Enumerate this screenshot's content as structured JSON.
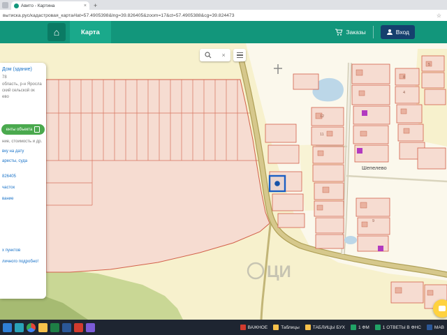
{
  "browser": {
    "tab_title": "Авито - Картина",
    "tab_close": "×",
    "new_tab_label": "+",
    "url": "вытиска.рус/кадастровая_карта#lat=57.4905398&lng=39.826405&zoom=17&ct=57.4905388&cg=39.824473",
    "bookmark_star": "☆"
  },
  "header": {
    "home_glyph": "⌂",
    "map_tab_label": "Карта",
    "orders_label": "Заказы",
    "login_label": "Вход"
  },
  "map_controls": {
    "clear_label": "×"
  },
  "panel": {
    "title_link": "Дом (здание)",
    "code_line": "78",
    "address_line1": "область, р-н Яросла",
    "address_line2": "ский сельской ок",
    "address_line3": "ево",
    "docs_button_label": "енты объекта",
    "info_line": "ние, стоимость и др.",
    "link_extract_date": "вку на дату",
    "link_arrests": "аресты, суда",
    "link_number": "826405",
    "link_parcel": "часток",
    "link_building": "вание",
    "link_settlements": "х пунктов",
    "link_more": "личного подробно!"
  },
  "map": {
    "village_label": "Шепелево",
    "parcel_numbers": [
      "8",
      "4",
      "12",
      "11",
      "5",
      "9"
    ],
    "watermark_text": "ЦИ"
  },
  "taskbar": {
    "items": [
      {
        "icon": "important-icon",
        "label": "ВАЖНОЕ"
      },
      {
        "icon": "folder-icon",
        "label": "Таблицы"
      },
      {
        "icon": "folder-icon",
        "label": "ТАБЛИЦЫ БУХ"
      },
      {
        "icon": "excel-icon",
        "label": "1 ФМ"
      },
      {
        "icon": "excel-icon",
        "label": "1 ОТВЕТЫ В ФНС"
      },
      {
        "icon": "word-icon",
        "label": "МАВ"
      }
    ]
  },
  "colors": {
    "header_teal": "#12967b",
    "accent_blue": "#1b5fc4",
    "link_blue": "#1a73c8",
    "parcel_fill": "#f6dcd1",
    "parcel_stroke": "#d2604a",
    "road_fill": "#d6c88c",
    "green_area": "#c9d795",
    "pond_blue": "#bcd7e8",
    "purple_building": "#b23ac0",
    "docs_button_green": "#4aa94e",
    "chat_yellow": "#ffd23f",
    "taskbar_bg": "#1e2531"
  }
}
